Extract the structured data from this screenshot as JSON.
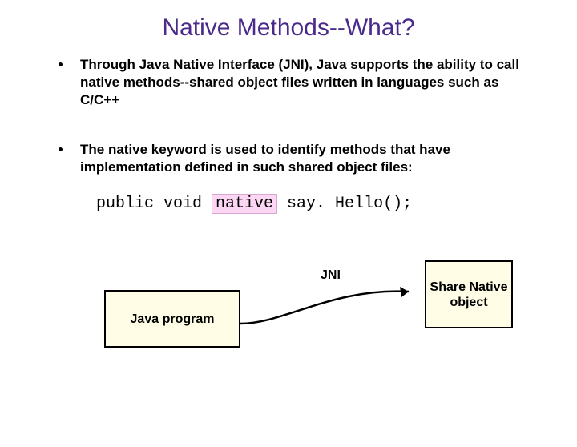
{
  "title": "Native Methods--What?",
  "bullets": [
    "Through Java Native Interface (JNI), Java supports the ability to call native methods--shared object files written in languages such as C/C++",
    "The native keyword is used to identify methods that have implementation defined in such shared object files:"
  ],
  "code": {
    "prefix": "public void ",
    "highlight": "native",
    "suffix": " say. Hello();"
  },
  "diagram": {
    "left_box": "Java program",
    "right_box": "Share Native object",
    "arrow_label": "JNI"
  }
}
